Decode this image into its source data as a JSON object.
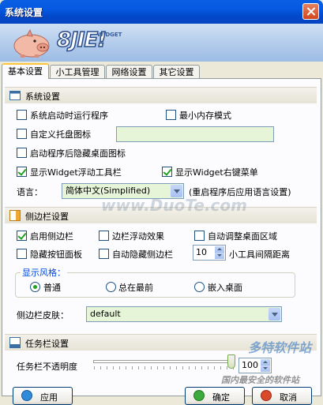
{
  "window": {
    "title": "系统设置"
  },
  "banner": {
    "logo_text": "8JIE!",
    "logo_sub": "WIDGET"
  },
  "tabs": [
    {
      "label": "基本设置"
    },
    {
      "label": "小工具管理"
    },
    {
      "label": "网络设置"
    },
    {
      "label": "其它设置"
    }
  ],
  "system": {
    "title": "系统设置",
    "startup": "系统启动时运行程序",
    "min_memory": "最小内存模式",
    "custom_tray": "自定义托盘图标",
    "tray_value": "",
    "hide_desktop": "启动程序后隐藏桌面图标",
    "show_toolbar": "显示Widget浮动工具栏",
    "show_context": "显示Widget右键菜单",
    "language_label": "语言：",
    "language_value": "简体中文(Simplified)",
    "language_note": "(重启程序后应用语言设置)"
  },
  "sidebar": {
    "title": "侧边栏设置",
    "enable": "启用侧边栏",
    "float_effect": "边栏浮动效果",
    "auto_adjust": "自动调整桌面区域",
    "hide_panel": "隐藏按钮面板",
    "auto_hide": "自动隐藏侧边栏",
    "spacing_value": "10",
    "spacing_label": "小工具间隔距离",
    "style_title": "显示风格：",
    "style_normal": "普通",
    "style_top": "总在最前",
    "style_embed": "嵌入桌面",
    "skin_label": "侧边栏皮肤：",
    "skin_value": "default"
  },
  "taskbar": {
    "title": "任务栏设置",
    "opacity_label": "任务栏不透明度",
    "opacity_value": "100"
  },
  "buttons": {
    "apply": "应用",
    "ok": "确定",
    "cancel": "取消"
  },
  "watermark": {
    "site": "www.DuoTe.com",
    "logo": "多特软件站",
    "sub": "国内最安全的软件站"
  },
  "states": {
    "startup": false,
    "min_memory": false,
    "custom_tray": false,
    "hide_desktop": false,
    "show_toolbar": true,
    "show_context": true,
    "enable_sidebar": true,
    "float_effect": false,
    "auto_adjust": false,
    "hide_panel": false,
    "auto_hide": false,
    "style": "普通",
    "opacity_fraction": 1.0
  },
  "colors": {
    "titlebar": "#0558E0",
    "groupbox_title": "#0046D5",
    "check": "#21A121",
    "input_bg": "#E6F5D8"
  }
}
